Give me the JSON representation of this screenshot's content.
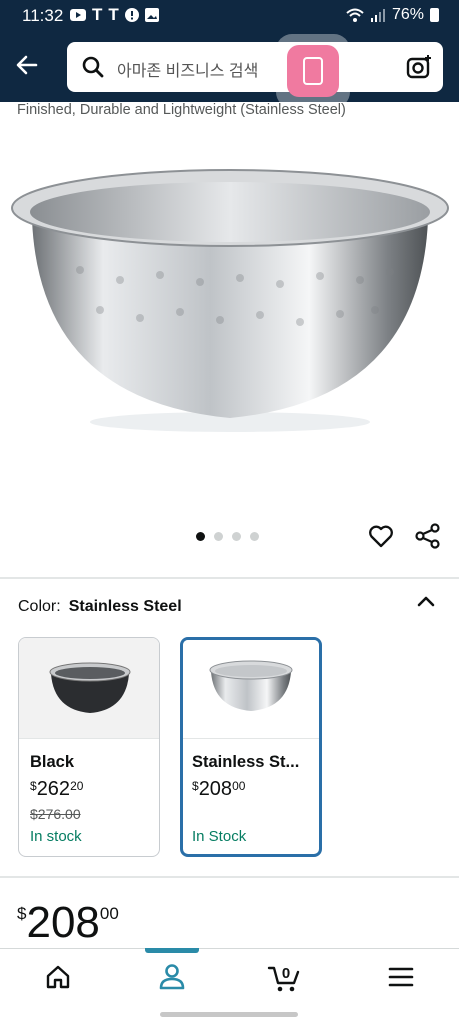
{
  "status_bar": {
    "time": "11:32",
    "battery": "76%"
  },
  "header": {
    "search_placeholder": "아마존 비즈니스 검색",
    "back_icon": "back-arrow-icon",
    "camera_icon": "camera-icon"
  },
  "product": {
    "title_fragment": "Finished, Durable and Lightweight (Stainless Steel)",
    "image_count": 4,
    "active_image": 1
  },
  "color_selector": {
    "label": "Color:",
    "selected_value": "Stainless Steel",
    "options": [
      {
        "name": "Black",
        "price_symbol": "$",
        "price_whole": "262",
        "price_cents": "20",
        "list_price": "$276.00",
        "stock": "In stock",
        "selected": false
      },
      {
        "name": "Stainless St...",
        "price_symbol": "$",
        "price_whole": "208",
        "price_cents": "00",
        "stock": "In Stock",
        "selected": true
      }
    ]
  },
  "price": {
    "symbol": "$",
    "whole": "208",
    "cents": "00"
  },
  "bottom_nav": {
    "items": [
      "home-icon",
      "account-icon",
      "cart-icon",
      "menu-icon"
    ],
    "cart_count": "0",
    "active_index": 1
  },
  "colors": {
    "header_bg": "#0f2841",
    "in_stock": "#067d62",
    "selected_border": "#2a6fa8",
    "nav_active": "#2a8ba8"
  }
}
